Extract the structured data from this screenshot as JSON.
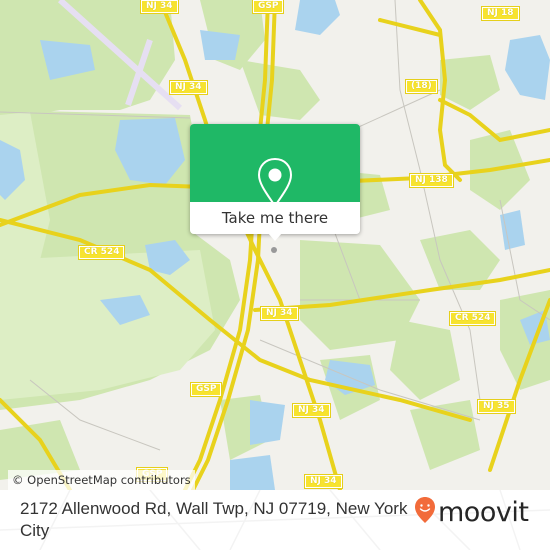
{
  "map": {
    "attribution": "© OpenStreetMap contributors",
    "road_labels": [
      {
        "id": "nj34-top",
        "text": "NJ 34"
      },
      {
        "id": "gsp-top",
        "text": "GSP"
      },
      {
        "id": "nj18",
        "text": "NJ 18"
      },
      {
        "id": "nj34-upper",
        "text": "NJ 34"
      },
      {
        "id": "rt18",
        "text": "(18)"
      },
      {
        "id": "nj138",
        "text": "NJ 138"
      },
      {
        "id": "cr524-west",
        "text": "CR 524"
      },
      {
        "id": "nj34-mid",
        "text": "NJ 34"
      },
      {
        "id": "cr524-east",
        "text": "CR 524"
      },
      {
        "id": "gsp-mid",
        "text": "GSP"
      },
      {
        "id": "nj34-south",
        "text": "NJ 34"
      },
      {
        "id": "nj35",
        "text": "NJ 35"
      },
      {
        "id": "gsp-bottom",
        "text": "GSP"
      },
      {
        "id": "nj34-bottom",
        "text": "NJ 34"
      }
    ],
    "colors": {
      "land": "#f2f1ec",
      "forest": "#cfe6b0",
      "park": "#ddeec5",
      "water": "#aad3ee",
      "road": "#f7e32f",
      "runway": "#e6dff2"
    }
  },
  "popup": {
    "icon": "map-pin-icon",
    "button_label": "Take me there",
    "accent_color": "#1fb866"
  },
  "footer": {
    "address": "2172 Allenwood Rd, Wall Twp, NJ 07719, New York City",
    "brand": "moovit",
    "brand_icon": "moovit-pin-logo-icon",
    "brand_color": "#f26b3a"
  }
}
